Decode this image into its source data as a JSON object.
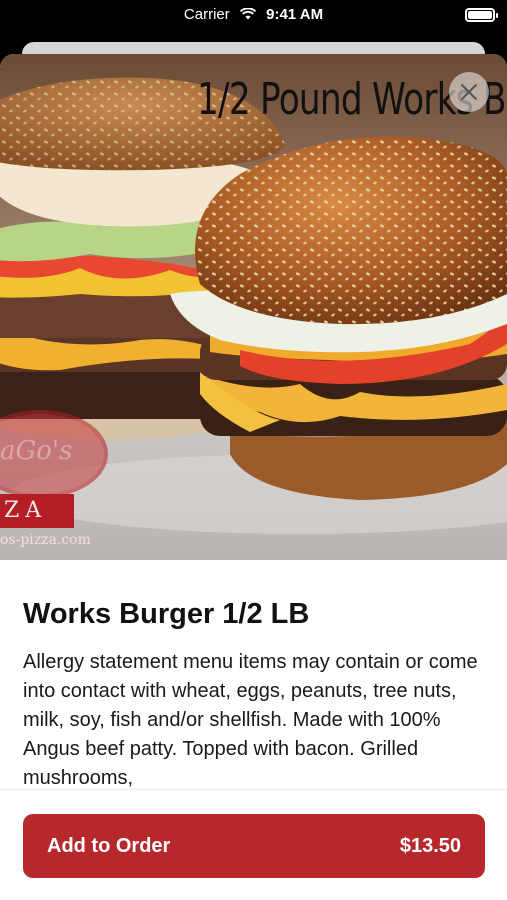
{
  "status_bar": {
    "carrier": "Carrier",
    "time": "9:41 AM"
  },
  "hero": {
    "overlay_text": "1/2 Pound Works B",
    "logo_script": "aGo's",
    "logo_block": "ZA",
    "logo_url": "os-pizza.com"
  },
  "item": {
    "title": "Works Burger 1/2 LB",
    "description": "Allergy statement menu items may contain or come into contact with wheat, eggs, peanuts, tree nuts, milk, soy, fish and/or shellfish. Made with 100% Angus beef patty. Topped with bacon. Grilled mushrooms,"
  },
  "order_button": {
    "label": "Add to Order",
    "price": "$13.50"
  },
  "colors": {
    "accent": "#b7282c"
  },
  "icons": {
    "close": "close-icon",
    "wifi": "wifi-icon",
    "battery": "battery-icon"
  }
}
